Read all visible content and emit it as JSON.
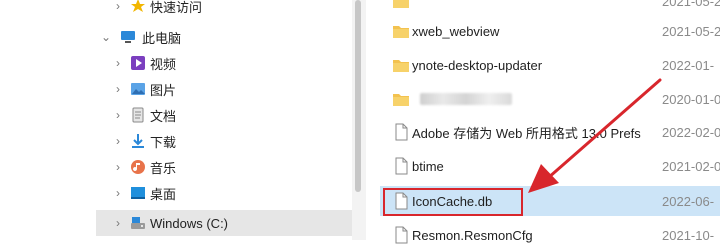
{
  "nav": {
    "items": [
      {
        "label": "快速访问",
        "icon": "star-icon",
        "chevron": "›",
        "level": 1
      },
      {
        "label": "此电脑",
        "icon": "computer-icon",
        "chevron": "⌄",
        "level": 0
      },
      {
        "label": "视频",
        "icon": "video-icon",
        "chevron": "›",
        "level": 1
      },
      {
        "label": "图片",
        "icon": "pictures-icon",
        "chevron": "›",
        "level": 1
      },
      {
        "label": "文档",
        "icon": "documents-icon",
        "chevron": "›",
        "level": 1
      },
      {
        "label": "下载",
        "icon": "downloads-icon",
        "chevron": "›",
        "level": 1
      },
      {
        "label": "音乐",
        "icon": "music-icon",
        "chevron": "›",
        "level": 1
      },
      {
        "label": "桌面",
        "icon": "desktop-icon",
        "chevron": "›",
        "level": 1
      },
      {
        "label": "Windows (C:)",
        "icon": "drive-icon",
        "chevron": "›",
        "level": 1,
        "selected": true
      }
    ]
  },
  "files": [
    {
      "name": "",
      "date": "2021-05-2",
      "type": "folder"
    },
    {
      "name": "xweb_webview",
      "date": "2021-05-2",
      "type": "folder"
    },
    {
      "name": "ynote-desktop-updater",
      "date": "2022-01-",
      "type": "folder"
    },
    {
      "name": "",
      "date": "2020-01-0",
      "type": "folder",
      "blurred": true
    },
    {
      "name": "Adobe 存储为 Web 所用格式 13.0 Prefs",
      "date": "2022-02-0",
      "type": "file"
    },
    {
      "name": "btime",
      "date": "2021-02-0",
      "type": "file"
    },
    {
      "name": "IconCache.db",
      "date": "2022-06-",
      "type": "file",
      "selected": true
    },
    {
      "name": "Resmon.ResmonCfg",
      "date": "2021-10-",
      "type": "file"
    }
  ],
  "colors": {
    "selection": "#cce4f7",
    "highlight_box": "#d8262c",
    "folder": "#f3c24f"
  }
}
